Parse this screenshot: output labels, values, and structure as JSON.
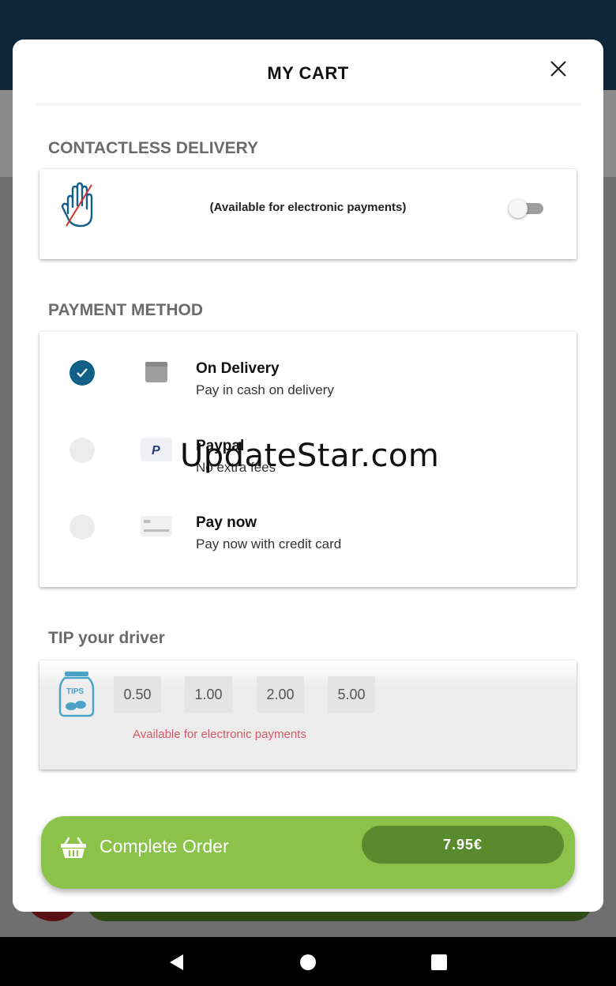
{
  "modal": {
    "title": "MY CART",
    "close_icon": "close-icon"
  },
  "contactless": {
    "section_title": "CONTACTLESS DELIVERY",
    "icon": "no-touch-hand-icon",
    "text": "(Available for electronic payments)",
    "toggle_on": false
  },
  "payment": {
    "section_title": "PAYMENT METHOD",
    "options": [
      {
        "title": "On Delivery",
        "subtitle": "Pay in cash on delivery",
        "icon": "wallet-icon",
        "selected": true
      },
      {
        "title": "Paypal",
        "subtitle": "No extra fees",
        "icon": "paypal-icon",
        "selected": false
      },
      {
        "title": "Pay now",
        "subtitle": "Pay now with credit card",
        "icon": "credit-card-icon",
        "selected": false
      }
    ]
  },
  "watermark": "UpdateStar.com",
  "tip": {
    "section_title": "TIP your driver",
    "jar_label": "TIPS",
    "amounts": [
      "0.50",
      "1.00",
      "2.00",
      "5.00"
    ],
    "note": "Available for electronic payments"
  },
  "order": {
    "label": "Complete Order",
    "price": "7.95€",
    "icon": "basket-icon"
  },
  "colors": {
    "header_bg": "#0c2538",
    "selected_radio": "#125f88",
    "order_button": "#8bc34a",
    "price_pill": "#5a8a2e",
    "tip_note": "#d35a6a"
  }
}
